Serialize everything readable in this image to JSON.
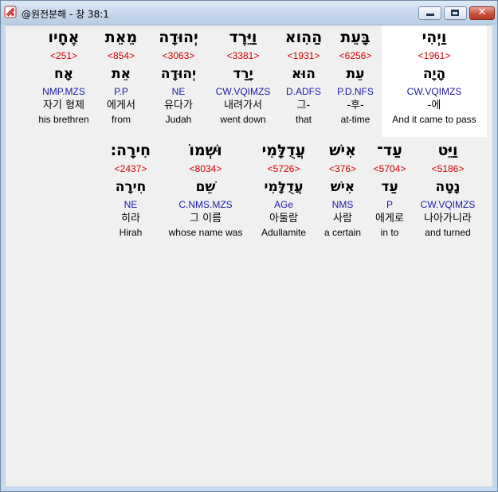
{
  "window": {
    "title": "@원전분해 - 창 38:1",
    "buttons": {
      "minimize": "minimize",
      "maximize": "maximize",
      "close": "✕"
    }
  },
  "verse": {
    "rows": [
      [
        {
          "heb": "וַיְהִי",
          "strong": "<1961>",
          "lemma": "הָיָה",
          "parse": "CW.VQIMZS",
          "kor": "-에",
          "eng": "And it came to pass",
          "highlight": true
        },
        {
          "heb": "בָּעֵת",
          "strong": "<6256>",
          "lemma": "עֵת",
          "parse": "P.D.NFS",
          "kor": "-후-",
          "eng": "at-time"
        },
        {
          "heb": "הַהִוא",
          "strong": "<1931>",
          "lemma": "הוּא",
          "parse": "D.ADFS",
          "kor": "그-",
          "eng": "that"
        },
        {
          "heb": "וַיֵּרֶד",
          "strong": "<3381>",
          "lemma": "יָרַד",
          "parse": "CW.VQIMZS",
          "kor": "내려가서",
          "eng": "went down"
        },
        {
          "heb": "יְהוּדָה",
          "strong": "<3063>",
          "lemma": "יְהוּדָה",
          "parse": "NE",
          "kor": "유다가",
          "eng": "Judah"
        },
        {
          "heb": "מֵאֵת",
          "strong": "<854>",
          "lemma": "אֵת",
          "parse": "P.P",
          "kor": "에게서",
          "eng": "from"
        },
        {
          "heb": "אֶחָיו",
          "strong": "<251>",
          "lemma": "אָח",
          "parse": "NMP.MZS",
          "kor": "자기 형제",
          "eng": "his brethren"
        }
      ],
      [
        {
          "heb": "וַיֵּט",
          "strong": "<5186>",
          "lemma": "נָטָה",
          "parse": "CW.VQIMZS",
          "kor": "나아가니라",
          "eng": "and turned"
        },
        {
          "heb": "עַד־",
          "strong": "<5704>",
          "lemma": "עַד",
          "parse": "P",
          "kor": "에게로",
          "eng": "in to"
        },
        {
          "heb": "אִישׁ",
          "strong": "<376>",
          "lemma": "אִישׁ",
          "parse": "NMS",
          "kor": "사람",
          "eng": "a certain"
        },
        {
          "heb": "עֲדֻלָּמִי",
          "strong": "<5726>",
          "lemma": "עֲדֻלָּמִי",
          "parse": "AGe",
          "kor": "아둘람",
          "eng": "Adullamite"
        },
        {
          "heb": "וּשְׁמוֹ",
          "strong": "<8034>",
          "lemma": "שֵׁם",
          "parse": "C.NMS.MZS",
          "kor": "그 이름",
          "eng": "whose name was"
        },
        {
          "heb": "חִירָה׃",
          "strong": "<2437>",
          "lemma": "חִירָה",
          "parse": "NE",
          "kor": "히라",
          "eng": "Hirah"
        }
      ]
    ]
  },
  "colors": {
    "strong": "#cc0000",
    "parse": "#1a1aa8",
    "highlight": "#ffffff"
  }
}
